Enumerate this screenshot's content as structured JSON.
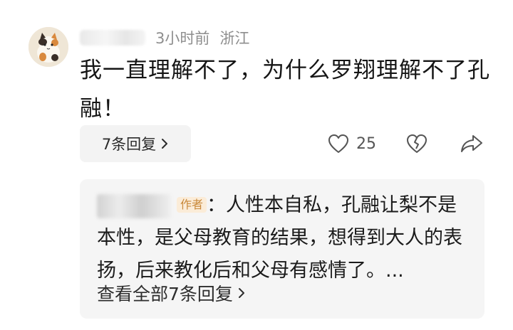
{
  "comment": {
    "time_ago": "3小时前",
    "location": "浙江",
    "text": "我一直理解不了，为什么罗翔理解不了孔融！",
    "replies_button_label": "7条回复",
    "like_count": "25"
  },
  "reply": {
    "author_badge": "作者",
    "text": "：人性本自私，孔融让梨不是本性，是父母教育的结果，想得到大人的表扬，后来教化后和父母有感情了。...",
    "view_all_label": "查看全部7条回复"
  },
  "icons": {
    "avatar": "cat-avatar",
    "like": "heart-icon",
    "dislike": "broken-heart-icon",
    "share": "share-icon",
    "chevron": "chevron-right-icon"
  },
  "colors": {
    "meta_text": "#8e8e8e",
    "badge_bg": "#fbecd8",
    "badge_text": "#c9893b",
    "reply_bg": "#f5f5f5"
  }
}
